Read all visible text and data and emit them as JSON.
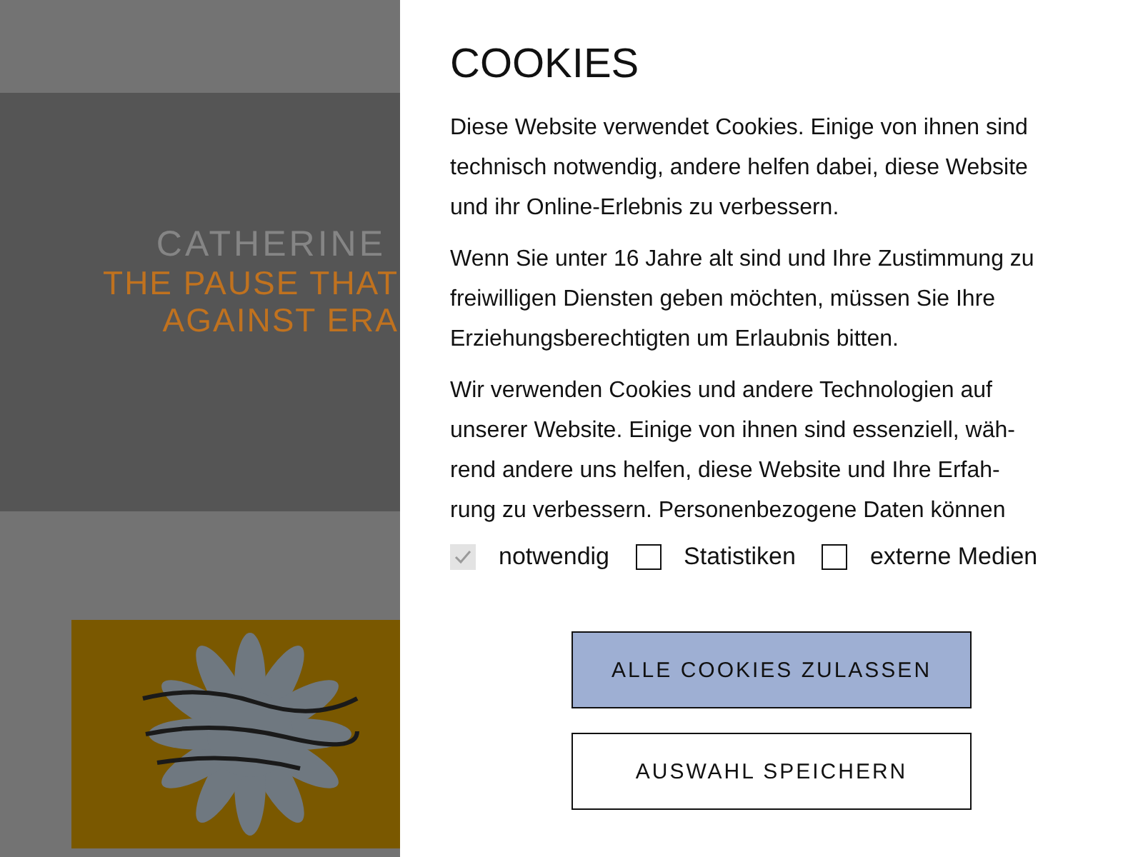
{
  "background_page": {
    "hero": {
      "subtitle": "CATHERINE",
      "title_lines": [
        "THE PAUSE THAT",
        "AGAINST ERA"
      ]
    }
  },
  "cookie_panel": {
    "title": "COOKIES",
    "paragraphs": [
      {
        "lines": [
          "Diese Website verwendet Cookies. Einige von ihnen sind",
          "technisch notwendig, andere helfen dabei, diese Website",
          "und ihr Online-Erlebnis zu verbessern."
        ]
      },
      {
        "lines": [
          "Wenn Sie unter 16 Jahre alt sind und Ihre Zustimmung zu",
          "freiwilligen Diensten geben möchten, müssen Sie Ihre",
          "Erziehungsberechtigten um Erlaubnis bitten."
        ]
      },
      {
        "lines": [
          "Wir verwenden Cookies und andere Technologien auf",
          "unserer Website. Einige von ihnen sind essenziell, wäh-",
          "rend andere uns helfen, diese Website und Ihre Erfah-",
          "rung zu verbessern. Personenbezogene Daten können"
        ]
      }
    ],
    "options": [
      {
        "label": "notwendig",
        "checked": true,
        "disabled": true
      },
      {
        "label": "Statistiken",
        "checked": false,
        "disabled": false
      },
      {
        "label": "externe Medien",
        "checked": false,
        "disabled": false
      }
    ],
    "buttons": [
      {
        "label": "ALLE COOKIES ZULASSEN",
        "kind": "primary"
      },
      {
        "label": "AUSWAHL SPEICHERN",
        "kind": "secondary"
      }
    ]
  }
}
